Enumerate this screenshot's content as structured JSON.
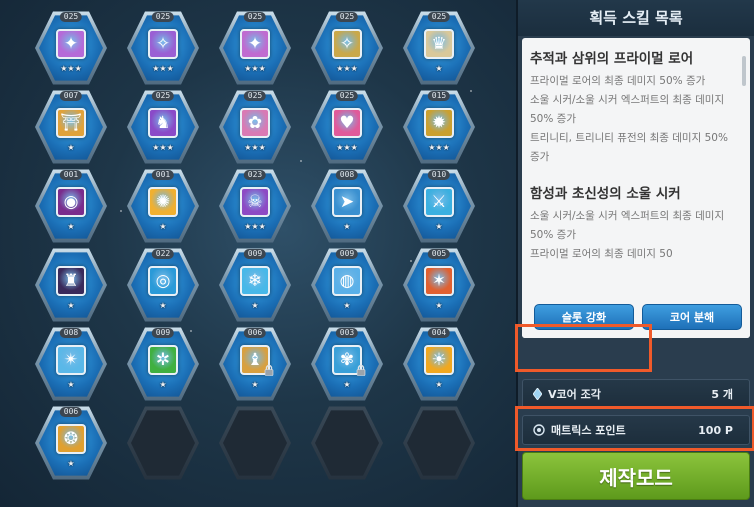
{
  "panel": {
    "title": "획득 스킬 목록"
  },
  "grid": {
    "slots": [
      {
        "level": "025",
        "stars": "★★★",
        "icon": "winged-emblem-icon",
        "color": "#b56ad8",
        "glyph": "✦",
        "locked": false
      },
      {
        "level": "025",
        "stars": "★★★",
        "icon": "winged-emblem-icon",
        "color": "#9a5fd4",
        "glyph": "✧",
        "locked": false
      },
      {
        "level": "025",
        "stars": "★★★",
        "icon": "winged-emblem-icon",
        "color": "#c06bd0",
        "glyph": "✦",
        "locked": false
      },
      {
        "level": "025",
        "stars": "★★★",
        "icon": "winged-emblem-icon",
        "color": "#c9a84a",
        "glyph": "✧",
        "locked": false
      },
      {
        "level": "025",
        "stars": "★",
        "icon": "goddess-icon",
        "color": "#d9c89a",
        "glyph": "♛",
        "locked": false
      },
      {
        "level": "007",
        "stars": "★",
        "icon": "golden-shrine-icon",
        "color": "#e0a23a",
        "glyph": "⛩",
        "locked": false
      },
      {
        "level": "025",
        "stars": "★★★",
        "icon": "dragon-icon",
        "color": "#8a4ac8",
        "glyph": "♞",
        "locked": false
      },
      {
        "level": "025",
        "stars": "★★★",
        "icon": "pink-beast-icon",
        "color": "#d97ab4",
        "glyph": "✿",
        "locked": false
      },
      {
        "level": "025",
        "stars": "★★★",
        "icon": "heart-icon",
        "color": "#e05a9a",
        "glyph": "♥",
        "locked": false
      },
      {
        "level": "015",
        "stars": "★★★",
        "icon": "golden-gear-icon",
        "color": "#caa030",
        "glyph": "✹",
        "locked": false
      },
      {
        "level": "001",
        "stars": "★",
        "icon": "eye-icon",
        "color": "#7a2c8c",
        "glyph": "◉",
        "locked": false
      },
      {
        "level": "001",
        "stars": "★",
        "icon": "sun-burst-icon",
        "color": "#f0b030",
        "glyph": "✺",
        "locked": false
      },
      {
        "level": "023",
        "stars": "★★★",
        "icon": "skull-icon",
        "color": "#8d4ac4",
        "glyph": "☠",
        "locked": false
      },
      {
        "level": "008",
        "stars": "★",
        "icon": "dash-icon",
        "color": "#3a90d0",
        "glyph": "➤",
        "locked": false
      },
      {
        "level": "010",
        "stars": "★",
        "icon": "blade-icon",
        "color": "#3ab0e0",
        "glyph": "⚔",
        "locked": false
      },
      {
        "level": "",
        "stars": "★",
        "icon": "dark-warrior-icon",
        "color": "#3a2a5a",
        "glyph": "♜",
        "locked": false
      },
      {
        "level": "022",
        "stars": "★",
        "icon": "target-icon",
        "color": "#2a9ad8",
        "glyph": "◎",
        "locked": false
      },
      {
        "level": "009",
        "stars": "★",
        "icon": "ice-pillar-icon",
        "color": "#48b8e8",
        "glyph": "❄",
        "locked": false
      },
      {
        "level": "009",
        "stars": "★",
        "icon": "water-orb-icon",
        "color": "#5ab0e8",
        "glyph": "◍",
        "locked": false
      },
      {
        "level": "005",
        "stars": "★",
        "icon": "flame-beast-icon",
        "color": "#e06030",
        "glyph": "✶",
        "locked": false
      },
      {
        "level": "008",
        "stars": "★",
        "icon": "frost-icon",
        "color": "#5ab8e8",
        "glyph": "✴",
        "locked": false
      },
      {
        "level": "009",
        "stars": "★",
        "icon": "green-gear-icon",
        "color": "#40b040",
        "glyph": "✲",
        "locked": false
      },
      {
        "level": "006",
        "stars": "★",
        "icon": "figure-icon",
        "color": "#d8a040",
        "glyph": "♝",
        "locked": true
      },
      {
        "level": "003",
        "stars": "★",
        "icon": "flower-icon",
        "color": "#3aa0d8",
        "glyph": "✾",
        "locked": true
      },
      {
        "level": "004",
        "stars": "★",
        "icon": "sun-icon",
        "color": "#f0a820",
        "glyph": "☀",
        "locked": false
      },
      {
        "level": "006",
        "stars": "★",
        "icon": "rune-icon",
        "color": "#e0a030",
        "glyph": "❂",
        "locked": false
      },
      {
        "empty": true
      },
      {
        "empty": true
      },
      {
        "empty": true
      },
      {
        "empty": true
      }
    ]
  },
  "description": {
    "sections": [
      {
        "heading": "추적과 삼위의 프라이멀 로어",
        "lines": [
          "프라이멀 로어의 최종 데미지 50% 증가",
          "소울 시커/소울 시커 엑스퍼트의 최종 데미지 50% 증가",
          "트리니티, 트리니티 퓨전의 최종 데미지 50% 증가"
        ]
      },
      {
        "heading": "함성과 초신성의 소울 시커",
        "lines": [
          "소울 시커/소울 시커 엑스퍼트의 최종 데미지 50% 증가",
          "프라이멀 로어의 최종 데미지 50"
        ]
      }
    ]
  },
  "buttons": {
    "slot_enhance": "슬롯 강화",
    "core_disassemble": "코어 분해",
    "craft_mode": "제작모드"
  },
  "resources": {
    "vcore_label": "V코어 조각",
    "vcore_value": "5 개",
    "matrix_label": "매트릭스 포인트",
    "matrix_value": "100  P"
  },
  "colors": {
    "highlight": "#f05a2a",
    "craft_green": "#7ab42e",
    "button_blue": "#2c86cc"
  }
}
